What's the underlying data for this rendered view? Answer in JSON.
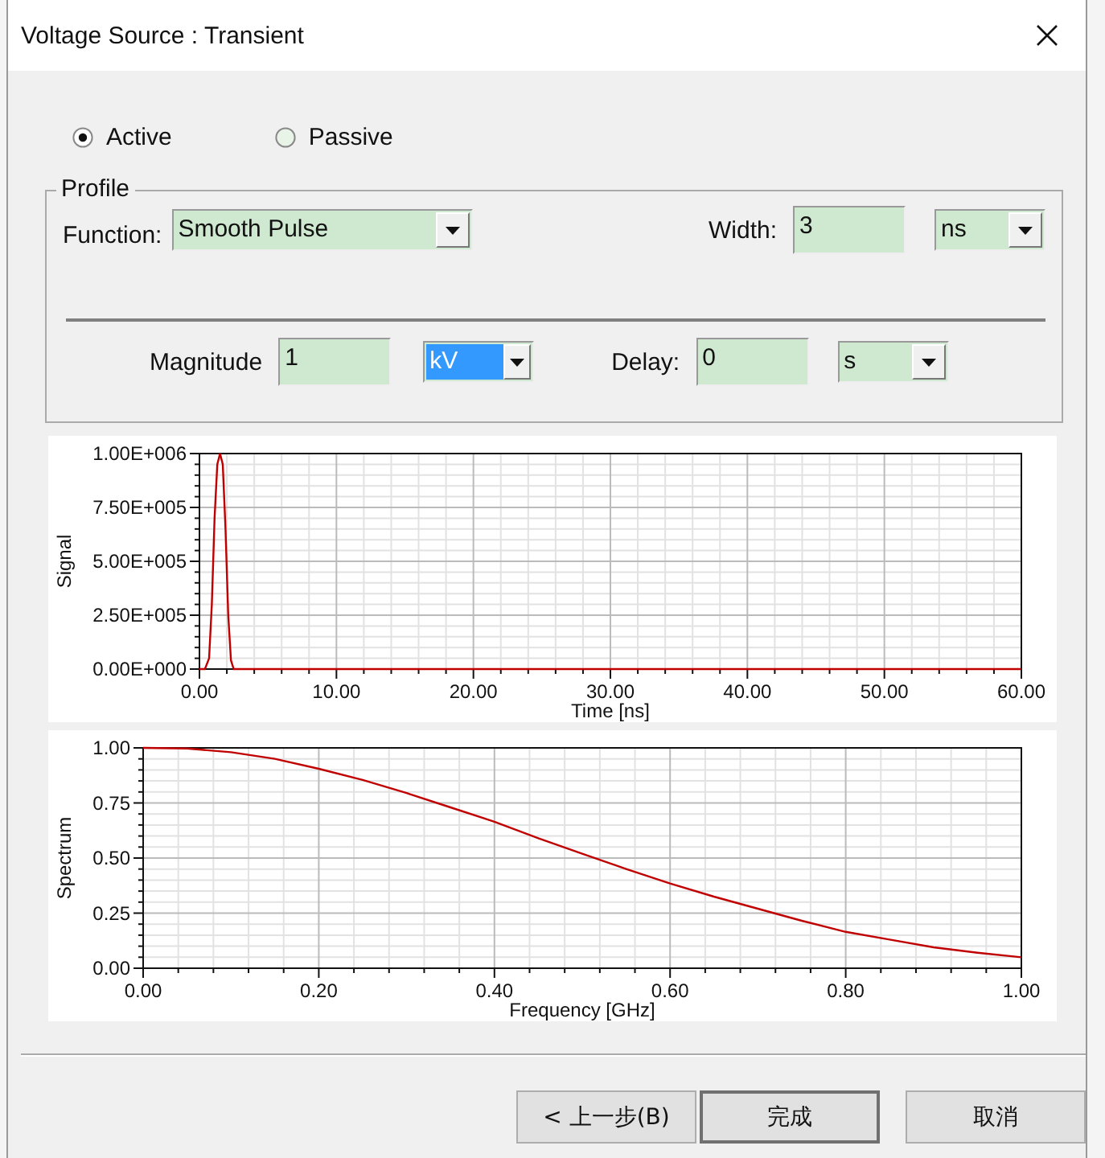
{
  "window": {
    "title": "Voltage Source : Transient"
  },
  "mode": [
    {
      "label": "Active",
      "selected": true
    },
    {
      "label": "Passive",
      "selected": false
    }
  ],
  "profile": {
    "title": "Profile",
    "function": {
      "label": "Function:",
      "value": "Smooth Pulse"
    },
    "width": {
      "label": "Width:",
      "value": "3",
      "unit": "ns",
      "unit_focused": false
    },
    "magnitude": {
      "label": "Magnitude",
      "value": "1",
      "unit": "kV",
      "unit_focused": true
    },
    "delay": {
      "label": "Delay:",
      "value": "0",
      "unit": "s",
      "unit_focused": false
    }
  },
  "charts": [
    {
      "chart_data": {
        "type": "line",
        "grid": true,
        "xlabel": "Time [ns]",
        "ylabel": "Signal",
        "xlim": [
          0,
          60
        ],
        "ylim": [
          0,
          1000000
        ],
        "xticks": [
          {
            "value": 0,
            "label": "0.00"
          },
          {
            "value": 10,
            "label": "10.00"
          },
          {
            "value": 20,
            "label": "20.00"
          },
          {
            "value": 30,
            "label": "30.00"
          },
          {
            "value": 40,
            "label": "40.00"
          },
          {
            "value": 50,
            "label": "50.00"
          },
          {
            "value": 60,
            "label": "60.00"
          }
        ],
        "yticks": [
          {
            "value": 0,
            "label": "0.00E+000"
          },
          {
            "value": 250000,
            "label": "2.50E+005"
          },
          {
            "value": 500000,
            "label": "5.00E+005"
          },
          {
            "value": 750000,
            "label": "7.50E+005"
          },
          {
            "value": 1000000,
            "label": "1.00E+006"
          }
        ],
        "x": [
          0,
          0.4,
          0.7,
          0.9,
          1.1,
          1.3,
          1.5,
          1.7,
          1.9,
          2.1,
          2.3,
          2.5,
          60
        ],
        "series": [
          {
            "color": "#c00000",
            "values": [
              0,
              0,
              50000,
              300000,
              700000,
              950000,
              1000000,
              950000,
              650000,
              250000,
              40000,
              0,
              0
            ]
          }
        ]
      }
    },
    {
      "chart_data": {
        "type": "line",
        "grid": true,
        "xlabel": "Frequency [GHz]",
        "ylabel": "Spectrum",
        "xlim": [
          0,
          1
        ],
        "ylim": [
          0,
          1
        ],
        "xticks": [
          {
            "value": 0,
            "label": "0.00"
          },
          {
            "value": 0.2,
            "label": "0.20"
          },
          {
            "value": 0.4,
            "label": "0.40"
          },
          {
            "value": 0.6,
            "label": "0.60"
          },
          {
            "value": 0.8,
            "label": "0.80"
          },
          {
            "value": 1,
            "label": "1.00"
          }
        ],
        "yticks": [
          {
            "value": 0,
            "label": "0.00"
          },
          {
            "value": 0.25,
            "label": "0.25"
          },
          {
            "value": 0.5,
            "label": "0.50"
          },
          {
            "value": 0.75,
            "label": "0.75"
          },
          {
            "value": 1,
            "label": "1.00"
          }
        ],
        "x": [
          0,
          0.05,
          0.1,
          0.15,
          0.2,
          0.25,
          0.3,
          0.35,
          0.4,
          0.45,
          0.5,
          0.55,
          0.6,
          0.65,
          0.7,
          0.75,
          0.8,
          0.85,
          0.9,
          0.95,
          1
        ],
        "series": [
          {
            "color": "#c00000",
            "values": [
              1,
              0.997,
              0.98,
              0.95,
              0.905,
              0.855,
              0.795,
              0.73,
              0.665,
              0.59,
              0.52,
              0.45,
              0.385,
              0.325,
              0.27,
              0.215,
              0.165,
              0.13,
              0.095,
              0.07,
              0.05
            ]
          }
        ]
      }
    }
  ],
  "buttons": [
    {
      "label": "< 上一步(B)",
      "default": false
    },
    {
      "label": "完成",
      "default": true
    },
    {
      "label": "取消",
      "default": false
    }
  ]
}
